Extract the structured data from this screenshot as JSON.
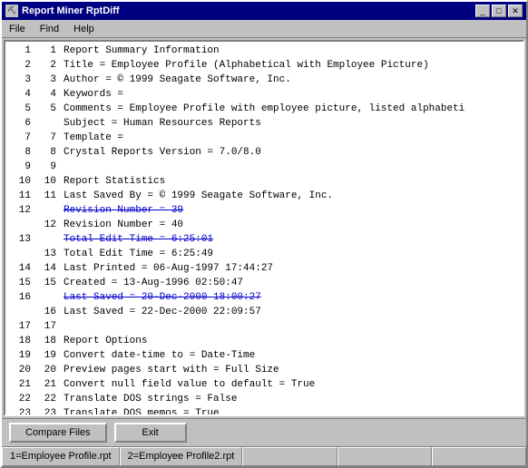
{
  "window": {
    "title": "Report Miner RptDiff",
    "icon": "📊"
  },
  "menu": {
    "items": [
      "File",
      "Find",
      "Help"
    ]
  },
  "lines": [
    {
      "outer": "1",
      "inner": "1",
      "text": "Report Summary Information",
      "type": "normal"
    },
    {
      "outer": "2",
      "inner": "2",
      "text": "Title = Employee Profile (Alphabetical with Employee Picture)",
      "type": "normal"
    },
    {
      "outer": "3",
      "inner": "3",
      "text": "Author = © 1999 Seagate Software, Inc.",
      "type": "normal"
    },
    {
      "outer": "4",
      "inner": "4",
      "text": "Keywords =",
      "type": "normal"
    },
    {
      "outer": "5",
      "inner": "5",
      "text": "Comments = Employee Profile with employee picture, listed alphabeti",
      "type": "normal"
    },
    {
      "outer": "",
      "inner": "",
      "text": "",
      "type": "empty"
    },
    {
      "outer": "6",
      "inner": "",
      "text": "Subject = Human Resources Reports",
      "type": "normal"
    },
    {
      "outer": "7",
      "inner": "7",
      "text": "Template =",
      "type": "normal"
    },
    {
      "outer": "8",
      "inner": "8",
      "text": "Crystal Reports Version = 7.0/8.0",
      "type": "normal"
    },
    {
      "outer": "9",
      "inner": "9",
      "text": "",
      "type": "normal"
    },
    {
      "outer": "10",
      "inner": "10",
      "text": "Report Statistics",
      "type": "normal"
    },
    {
      "outer": "11",
      "inner": "11",
      "text": "Last Saved By = © 1999 Seagate Software, Inc.",
      "type": "normal"
    },
    {
      "outer": "12",
      "inner": "",
      "text": "Revision Number = 39",
      "type": "deleted"
    },
    {
      "outer": "",
      "inner": "12",
      "text": "Revision Number = 40",
      "type": "normal"
    },
    {
      "outer": "13",
      "inner": "",
      "text": "Total Edit Time = 6:25:01",
      "type": "deleted"
    },
    {
      "outer": "",
      "inner": "13",
      "text": "Total Edit Time = 6:25:49",
      "type": "normal"
    },
    {
      "outer": "14",
      "inner": "14",
      "text": "Last Printed = 06-Aug-1997 17:44:27",
      "type": "normal"
    },
    {
      "outer": "15",
      "inner": "15",
      "text": "Created = 13-Aug-1996 02:50:47",
      "type": "normal"
    },
    {
      "outer": "16",
      "inner": "",
      "text": "Last Saved = 20-Dec-2000 18:00:27",
      "type": "deleted"
    },
    {
      "outer": "",
      "inner": "16",
      "text": "Last Saved = 22-Dec-2000 22:09:57",
      "type": "normal"
    },
    {
      "outer": "17",
      "inner": "17",
      "text": "",
      "type": "normal"
    },
    {
      "outer": "18",
      "inner": "18",
      "text": "Report Options",
      "type": "normal"
    },
    {
      "outer": "19",
      "inner": "19",
      "text": "Convert date-time to = Date-Time",
      "type": "normal"
    },
    {
      "outer": "20",
      "inner": "20",
      "text": "Preview pages start with = Full Size",
      "type": "normal"
    },
    {
      "outer": "21",
      "inner": "21",
      "text": "Convert null field value to default = True",
      "type": "normal"
    },
    {
      "outer": "22",
      "inner": "22",
      "text": "Translate DOS strings = False",
      "type": "normal"
    },
    {
      "outer": "23",
      "inner": "23",
      "text": "Translate DOS memos = True",
      "type": "normal"
    }
  ],
  "buttons": {
    "compare": "Compare Files",
    "exit": "Exit"
  },
  "statusbar": {
    "item1": "1=Employee Profile.rpt",
    "item2": "2=Employee Profile2.rpt"
  },
  "title_buttons": {
    "minimize": "_",
    "maximize": "□",
    "close": "✕"
  }
}
